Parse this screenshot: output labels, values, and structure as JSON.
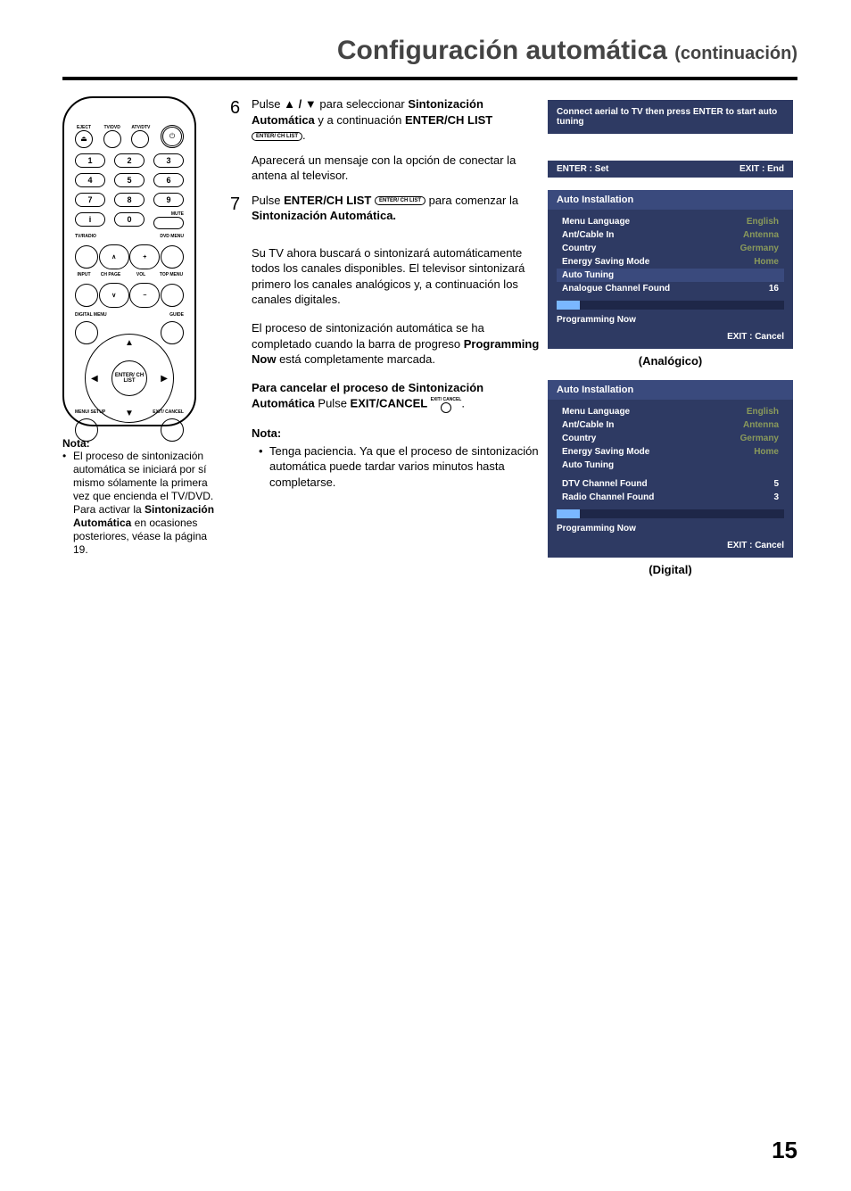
{
  "page": {
    "title_main": "Configuración automática",
    "title_sub": "(continuación)",
    "page_number": "15"
  },
  "remote": {
    "top_labels": [
      "EJECT",
      "TV/DVD",
      "ATV/DTV",
      ""
    ],
    "numpad": [
      [
        "1",
        "2",
        "3"
      ],
      [
        "4",
        "5",
        "6"
      ],
      [
        "7",
        "8",
        "9"
      ],
      [
        "i",
        "0",
        ""
      ]
    ],
    "mute": "MUTE",
    "row_lbl_left": "TV/RADIO",
    "row_lbl_right": "DVD MENU",
    "mid_labels": [
      "INPUT",
      "CH PAGE",
      "VOL",
      "TOP MENU"
    ],
    "digital": "DIGITAL MENU",
    "guide": "GUIDE",
    "enter": "ENTER/ CH LIST",
    "menu_setup": "MENU/ SETUP",
    "exit_cancel": "EXIT/ CANCEL"
  },
  "left_note": {
    "hdr": "Nota:",
    "body_pre": "El proceso de sintonización automática se iniciará por sí mismo sólamente la primera vez que encienda el TV/DVD. Para activar la ",
    "body_bold": "Sintonización Automática",
    "body_post": " en ocasiones posteriores, véase la página 19."
  },
  "step6": {
    "num": "6",
    "t1": "Pulse ",
    "t2": " para seleccionar ",
    "bold1": "Sintonización Automática",
    "t3": " y a continuación ",
    "bold2": "ENTER/CH LIST",
    "icon": "ENTER/ CH LIST",
    "para": "Aparecerá un mensaje con la opción de conectar la antena al televisor."
  },
  "step7": {
    "num": "7",
    "t1": "Pulse ",
    "bold1": "ENTER/CH LIST",
    "icon": "ENTER/ CH LIST",
    "t2": " para comenzar la ",
    "bold2": "Sintonización Automática.",
    "p1": "Su TV ahora buscará o sintonizará automáticamente todos los canales disponibles. El televisor sintonizará primero los canales analógicos y, a continuación los canales digitales.",
    "p2a": "El proceso de sintonización automática se ha completado cuando la barra de progreso ",
    "p2b": "Programming Now",
    "p2c": " está completamente marcada.",
    "cancel_hdr_a": "Para cancelar el proceso de Sintonización Automática",
    "cancel_b": " Pulse ",
    "cancel_bold": " EXIT/CANCEL ",
    "cancel_icon": "EXIT/ CANCEL",
    "nota": "Nota:",
    "nota_body": "Tenga paciencia. Ya que el proceso de sintoni­zación automática puede tardar varios minutos hasta completarse."
  },
  "osd1": {
    "msg": "Connect aerial to TV then press ENTER to start auto tuning",
    "foot_left": "ENTER : Set",
    "foot_right": "EXIT : End"
  },
  "panelA": {
    "title": "Auto Installation",
    "rows": [
      {
        "k": "Menu Language",
        "v": "English"
      },
      {
        "k": "Ant/Cable In",
        "v": "Antenna"
      },
      {
        "k": "Country",
        "v": "Germany"
      },
      {
        "k": "Energy Saving Mode",
        "v": "Home"
      }
    ],
    "auto_tuning": "Auto Tuning",
    "found_k": "Analogue Channel Found",
    "found_v": "16",
    "progress_pct": 10,
    "prog_label": "Programming Now",
    "exit": "EXIT : Cancel",
    "caption": "(Analógico)"
  },
  "panelB": {
    "title": "Auto Installation",
    "rows": [
      {
        "k": "Menu Language",
        "v": "English"
      },
      {
        "k": "Ant/Cable In",
        "v": "Antenna"
      },
      {
        "k": "Country",
        "v": "Germany"
      },
      {
        "k": "Energy Saving Mode",
        "v": "Home"
      }
    ],
    "auto_tuning": "Auto Tuning",
    "found": [
      {
        "k": "DTV Channel Found",
        "v": "5"
      },
      {
        "k": "Radio Channel Found",
        "v": "3"
      }
    ],
    "progress_pct": 10,
    "prog_label": "Programming Now",
    "exit": "EXIT : Cancel",
    "caption": "(Digital)"
  }
}
